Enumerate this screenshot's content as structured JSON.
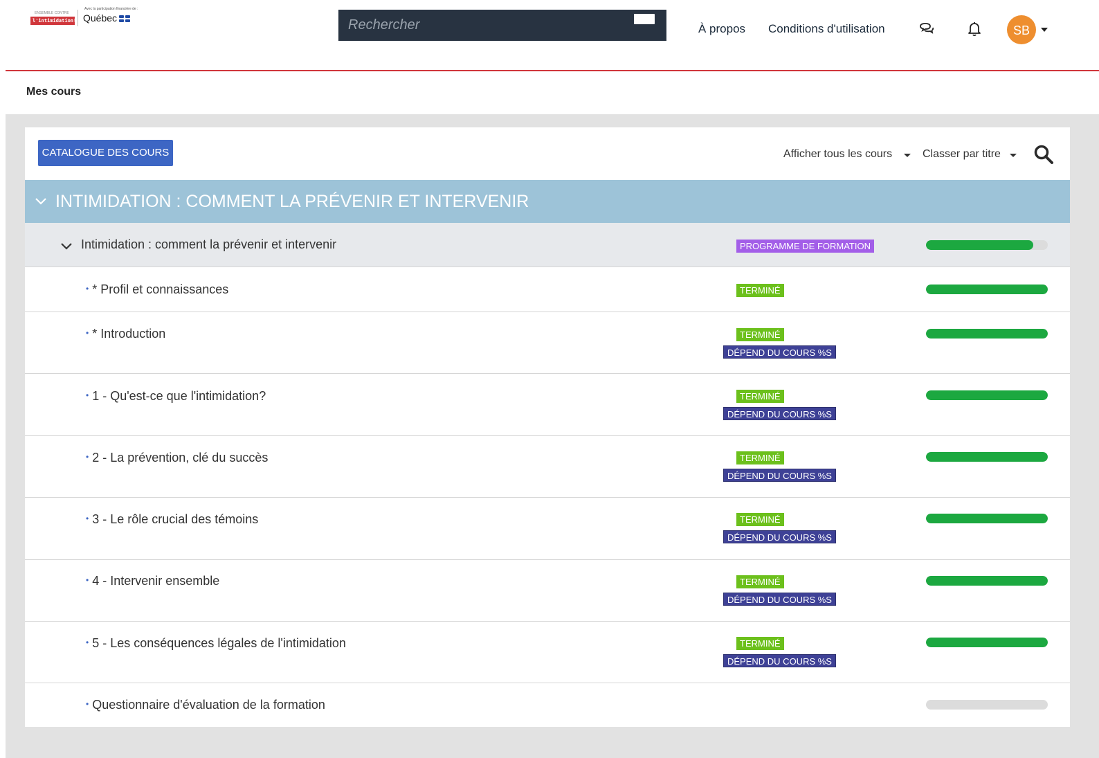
{
  "header": {
    "logo_left_small": "ENSEMBLE CONTRE",
    "logo_left_main": "l'intimidation!",
    "logo_qc_small": "Avec la participation financière de :",
    "logo_qc": "Québec",
    "search_placeholder": "Rechercher",
    "nav": [
      "À propos",
      "Conditions d'utilisation"
    ],
    "user_initials": "SB",
    "accent_color": "#d0363b",
    "avatar_color": "#ee8e2f"
  },
  "breadcrumb": "Mes cours",
  "toolbar": {
    "catalog_label": "CATALOGUE DES COURS",
    "filter_label": "Afficher tous les cours",
    "sort_label": "Classer par titre"
  },
  "program": {
    "title": "INTIMIDATION : COMMENT LA PRÉVENIR ET INTERVENIR",
    "subprogram_title": "Intimidation : comment la prévenir et intervenir",
    "subprogram_badge": "PROGRAMME DE FORMATION",
    "subprogram_progress": 0.88
  },
  "courses": [
    {
      "title": "* Profil et connaissances",
      "status": "TERMINÉ",
      "dependency": "",
      "progress": 1.0
    },
    {
      "title": "* Introduction",
      "status": "TERMINÉ",
      "dependency": "DÉPEND DU COURS %S",
      "progress": 1.0
    },
    {
      "title": "1 - Qu'est-ce que l'intimidation?",
      "status": "TERMINÉ",
      "dependency": "DÉPEND DU COURS %S",
      "progress": 1.0
    },
    {
      "title": "2 - La prévention, clé du succès",
      "status": "TERMINÉ",
      "dependency": "DÉPEND DU COURS %S",
      "progress": 1.0
    },
    {
      "title": "3 - Le rôle crucial des témoins",
      "status": "TERMINÉ",
      "dependency": "DÉPEND DU COURS %S",
      "progress": 1.0
    },
    {
      "title": "4 - Intervenir ensemble",
      "status": "TERMINÉ",
      "dependency": "DÉPEND DU COURS %S",
      "progress": 1.0
    },
    {
      "title": "5 - Les conséquences légales de l'intimidation",
      "status": "TERMINÉ",
      "dependency": "DÉPEND DU COURS %S",
      "progress": 1.0
    },
    {
      "title": "Questionnaire d'évaluation de la formation",
      "status": "",
      "dependency": "",
      "progress": 0.0
    }
  ]
}
